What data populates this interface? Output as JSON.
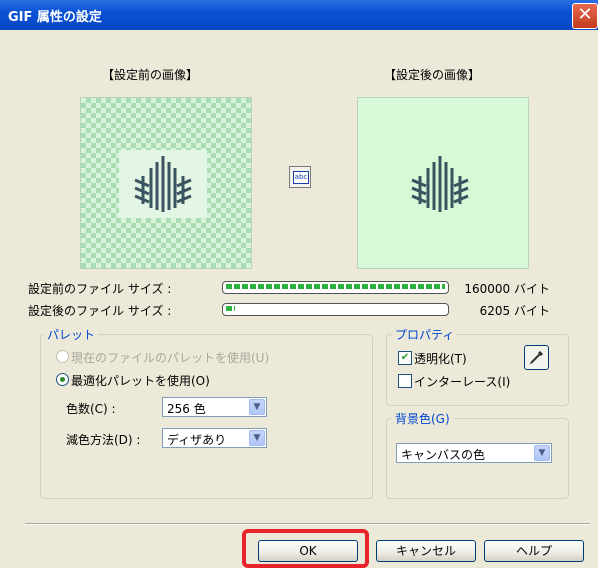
{
  "window": {
    "title": "GIF 属性の設定",
    "close_glyph": "✕"
  },
  "preview": {
    "before_label": "【設定前の画像】",
    "after_label": "【設定後の画像】",
    "apply_icon_text": "abc"
  },
  "filesize": {
    "before_label": "設定前のファイル サイズ :",
    "before_value": "160000 バイト",
    "before_ratio": 1.0,
    "after_label": "設定後のファイル サイズ :",
    "after_value": "6205 バイト",
    "after_ratio": 0.04
  },
  "palette": {
    "title": "パレット",
    "option_current": "現在のファイルのパレットを使用(U)",
    "option_optimized": "最適化パレットを使用(O)",
    "colors_label": "色数(C) :",
    "colors_value": "256 色",
    "dither_label": "減色方法(D) :",
    "dither_value": "ディザあり"
  },
  "properties": {
    "title": "プロパティ",
    "transparent_label": "透明化(T)",
    "transparent_checked": true,
    "interlace_label": "インターレース(I)",
    "interlace_checked": false
  },
  "background": {
    "title": "背景色(G)",
    "value": "キャンバスの色"
  },
  "buttons": {
    "ok": "OK",
    "cancel": "キャンセル",
    "help": "ヘルプ"
  },
  "colors": {
    "title_bar": "#0a52d6",
    "group_title": "#0046d5",
    "highlight": "#e8232a",
    "progress": "#2fb33f"
  }
}
